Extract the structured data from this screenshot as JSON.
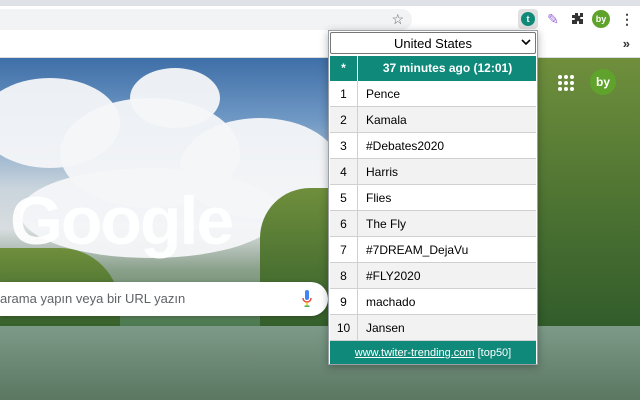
{
  "toolbar": {
    "star_icon": "star-icon",
    "avatar_initials": "by",
    "menu_icon": "⋮",
    "pen_icon": "✎",
    "twitter_ext_glyph": "t"
  },
  "bookmarks": {
    "overflow": "»"
  },
  "newtab": {
    "logo": "Google",
    "search_placeholder": "arama yapın veya bir URL yazın",
    "avatar_initials": "by"
  },
  "popup": {
    "country": "United States",
    "header_rank": "*",
    "header_time": "37 minutes ago (12:01)",
    "trends": [
      {
        "rank": "1",
        "term": "Pence"
      },
      {
        "rank": "2",
        "term": "Kamala"
      },
      {
        "rank": "3",
        "term": "#Debates2020"
      },
      {
        "rank": "4",
        "term": "Harris"
      },
      {
        "rank": "5",
        "term": "Flies"
      },
      {
        "rank": "6",
        "term": "The Fly"
      },
      {
        "rank": "7",
        "term": "#7DREAM_DejaVu"
      },
      {
        "rank": "8",
        "term": "#FLY2020"
      },
      {
        "rank": "9",
        "term": "machado"
      },
      {
        "rank": "10",
        "term": "Jansen"
      }
    ],
    "footer_link": "www.twiter-trending.com",
    "footer_suffix": "[top50]"
  },
  "colors": {
    "accent": "#0f8a7a",
    "avatar": "#5fa22c"
  }
}
